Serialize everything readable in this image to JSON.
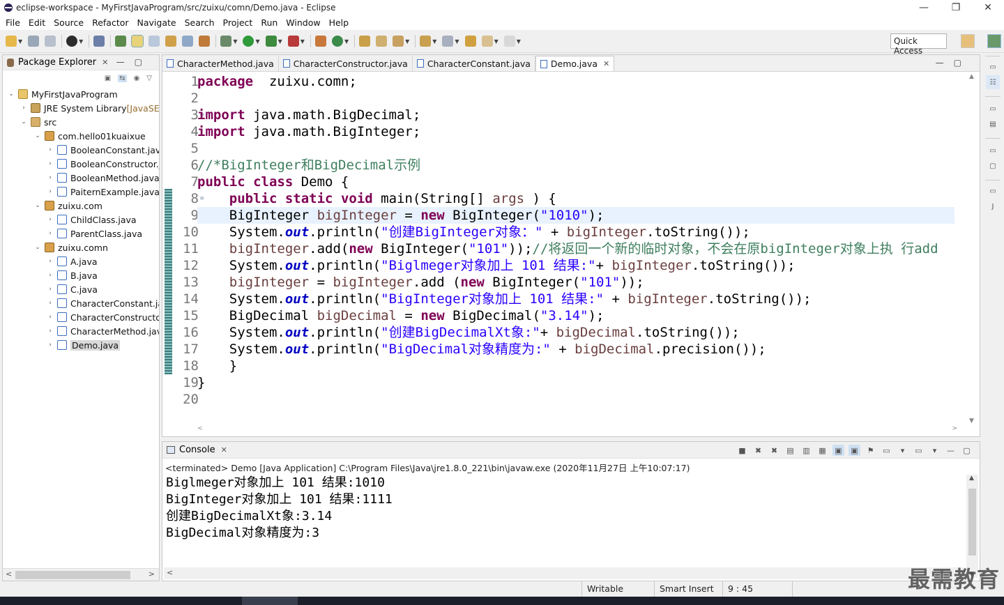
{
  "window": {
    "title": "eclipse-workspace - MyFirstJavaProgram/src/zuixu/comn/Demo.java - Eclipse"
  },
  "window_buttons": {
    "minimize": "—",
    "restore": "❐",
    "close": "✕"
  },
  "menu": [
    "File",
    "Edit",
    "Source",
    "Refactor",
    "Navigate",
    "Search",
    "Project",
    "Run",
    "Window",
    "Help"
  ],
  "quick_access": "Quick Access",
  "package_explorer": {
    "title": "Package Explorer",
    "tree": [
      {
        "label": "MyFirstJavaProgram",
        "icon": "project-icon",
        "arrow": "expanded"
      },
      {
        "label": "JRE System Library",
        "suffix": "[JavaSE-",
        "icon": "library-icon",
        "arrow": "collapsed"
      },
      {
        "label": "src",
        "icon": "source-folder-icon",
        "arrow": "expanded"
      },
      {
        "label": "com.hello01kuaixue",
        "icon": "package-icon",
        "arrow": "expanded"
      },
      {
        "label": "BooleanConstant.java",
        "icon": "java-file-icon",
        "arrow": "collapsed"
      },
      {
        "label": "BooleanConstructor.j",
        "icon": "java-file-icon",
        "arrow": "collapsed"
      },
      {
        "label": "BooleanMethod.java",
        "icon": "java-file-icon",
        "arrow": "collapsed"
      },
      {
        "label": "PaiternExample.java",
        "icon": "java-file-icon",
        "arrow": "collapsed"
      },
      {
        "label": "zuixu.com",
        "icon": "package-icon",
        "arrow": "expanded"
      },
      {
        "label": "ChildClass.java",
        "icon": "java-file-icon",
        "arrow": "collapsed"
      },
      {
        "label": "ParentClass.java",
        "icon": "java-file-icon",
        "arrow": "collapsed"
      },
      {
        "label": "zuixu.comn",
        "icon": "package-icon",
        "arrow": "expanded"
      },
      {
        "label": "A.java",
        "icon": "java-file-icon",
        "arrow": "collapsed"
      },
      {
        "label": "B.java",
        "icon": "java-file-icon",
        "arrow": "collapsed"
      },
      {
        "label": "C.java",
        "icon": "java-file-icon",
        "arrow": "collapsed"
      },
      {
        "label": "CharacterConstant.ja",
        "icon": "java-file-icon",
        "arrow": "collapsed"
      },
      {
        "label": "CharacterConstructor",
        "icon": "java-file-icon",
        "arrow": "collapsed"
      },
      {
        "label": "CharacterMethod.jav",
        "icon": "java-file-icon",
        "arrow": "collapsed"
      },
      {
        "label": "Demo.java",
        "icon": "java-file-icon",
        "arrow": "collapsed",
        "selected": true
      }
    ]
  },
  "editor": {
    "tabs": [
      {
        "label": "CharacterMethod.java",
        "active": false
      },
      {
        "label": "CharacterConstructor.java",
        "active": false
      },
      {
        "label": "CharacterConstant.java",
        "active": false
      },
      {
        "label": "Demo.java",
        "active": true
      }
    ],
    "lines": [
      {
        "n": "1",
        "tokens": [
          [
            "kw",
            "package"
          ],
          [
            "",
            "  zuixu.comn;"
          ]
        ]
      },
      {
        "n": "2",
        "tokens": []
      },
      {
        "n": "3",
        "fold": true,
        "tokens": [
          [
            "kw",
            "import"
          ],
          [
            "",
            " java.math.BigDecimal;"
          ]
        ]
      },
      {
        "n": "4",
        "tokens": [
          [
            "kw",
            "import"
          ],
          [
            "",
            " java.math.BigInteger;"
          ]
        ]
      },
      {
        "n": "5",
        "tokens": []
      },
      {
        "n": "6",
        "tokens": [
          [
            "cmt",
            "//*BigInteger和BigDecimal示例"
          ]
        ]
      },
      {
        "n": "7",
        "tokens": [
          [
            "kw",
            "public"
          ],
          [
            "",
            " "
          ],
          [
            "kw",
            "class"
          ],
          [
            "",
            " Demo {"
          ]
        ]
      },
      {
        "n": "8",
        "fold": true,
        "tokens": [
          [
            "",
            "    "
          ],
          [
            "kw",
            "public"
          ],
          [
            "",
            " "
          ],
          [
            "kw",
            "static"
          ],
          [
            "",
            " "
          ],
          [
            "kw",
            "void"
          ],
          [
            "",
            " main(String[] "
          ],
          [
            "var",
            "args"
          ],
          [
            "",
            " ) {"
          ]
        ]
      },
      {
        "n": "9",
        "highlight": true,
        "tokens": [
          [
            "",
            "    BigInteger "
          ],
          [
            "var",
            "bigInteger"
          ],
          [
            "",
            " = "
          ],
          [
            "kw",
            "new"
          ],
          [
            "",
            " BigInteger("
          ],
          [
            "str",
            "\"1010\""
          ],
          [
            "",
            ");"
          ]
        ]
      },
      {
        "n": "10",
        "tokens": [
          [
            "",
            "    System."
          ],
          [
            "fld",
            "out"
          ],
          [
            "",
            ".println("
          ],
          [
            "str",
            "\"创建BigInteger对象：\""
          ],
          [
            "",
            " + "
          ],
          [
            "var",
            "bigInteger"
          ],
          [
            "",
            ".toString());"
          ]
        ]
      },
      {
        "n": "11",
        "tokens": [
          [
            "",
            "    "
          ],
          [
            "var",
            "bigInteger"
          ],
          [
            "",
            ".add("
          ],
          [
            "kw",
            "new"
          ],
          [
            "",
            " BigInteger("
          ],
          [
            "str",
            "\"101\""
          ],
          [
            "",
            "));"
          ],
          [
            "cmt",
            "//将返回一个新的临时对象，不会在原bigInteger对象上执 行add"
          ]
        ]
      },
      {
        "n": "12",
        "tokens": [
          [
            "",
            "    System."
          ],
          [
            "fld",
            "out"
          ],
          [
            "",
            ".println("
          ],
          [
            "str",
            "\"Biglmeger对象加上 101 结果:\""
          ],
          [
            "",
            "+ "
          ],
          [
            "var",
            "bigInteger"
          ],
          [
            "",
            ".toString());"
          ]
        ]
      },
      {
        "n": "13",
        "tokens": [
          [
            "",
            "    "
          ],
          [
            "var",
            "bigInteger"
          ],
          [
            "",
            " = "
          ],
          [
            "var",
            "bigInteger"
          ],
          [
            "",
            ".add ("
          ],
          [
            "kw",
            "new"
          ],
          [
            "",
            " BigInteger("
          ],
          [
            "str",
            "\"101\""
          ],
          [
            "",
            "));"
          ]
        ]
      },
      {
        "n": "14",
        "tokens": [
          [
            "",
            "    System."
          ],
          [
            "fld",
            "out"
          ],
          [
            "",
            ".println("
          ],
          [
            "str",
            "\"BigInteger对象加上 101 结果:\""
          ],
          [
            "",
            " + "
          ],
          [
            "var",
            "bigInteger"
          ],
          [
            "",
            ".toString());"
          ]
        ]
      },
      {
        "n": "15",
        "tokens": [
          [
            "",
            "    BigDecimal "
          ],
          [
            "var",
            "bigDecimal"
          ],
          [
            "",
            " = "
          ],
          [
            "kw",
            "new"
          ],
          [
            "",
            " BigDecimal("
          ],
          [
            "str",
            "\"3.14\""
          ],
          [
            "",
            ");"
          ]
        ]
      },
      {
        "n": "16",
        "tokens": [
          [
            "",
            "    System."
          ],
          [
            "fld",
            "out"
          ],
          [
            "",
            ".println("
          ],
          [
            "str",
            "\"创建BigDecimalXt象:\""
          ],
          [
            "",
            "+ "
          ],
          [
            "var",
            "bigDecimal"
          ],
          [
            "",
            ".toString());"
          ]
        ]
      },
      {
        "n": "17",
        "tokens": [
          [
            "",
            "    System."
          ],
          [
            "fld",
            "out"
          ],
          [
            "",
            ".println("
          ],
          [
            "str",
            "\"BigDecimal对象精度为:\""
          ],
          [
            "",
            " + "
          ],
          [
            "var",
            "bigDecimal"
          ],
          [
            "",
            ".precision());"
          ]
        ]
      },
      {
        "n": "18",
        "tokens": [
          [
            "",
            "    }"
          ]
        ]
      },
      {
        "n": "19",
        "tokens": [
          [
            "",
            "}"
          ]
        ]
      },
      {
        "n": "20",
        "tokens": []
      }
    ]
  },
  "console": {
    "title": "Console",
    "status": "<terminated> Demo [Java Application] C:\\Program Files\\Java\\jre1.8.0_221\\bin\\javaw.exe (2020年11月27日 上午10:07:17)",
    "output": [
      "Biglmeger对象加上 101 结果:1010",
      "BigInteger对象加上 101 结果:1111",
      "创建BigDecimalXt象:3.14",
      "BigDecimal对象精度为:3"
    ]
  },
  "status_bar": {
    "mode": "Writable",
    "insert": "Smart Insert",
    "position": "9 : 45"
  },
  "watermark": "最需教育",
  "colors": {
    "keyword": "#7f0055",
    "string": "#2a00ff",
    "comment": "#3f7f5f",
    "field": "#0000c0",
    "highlight": "#e8f2fe"
  }
}
